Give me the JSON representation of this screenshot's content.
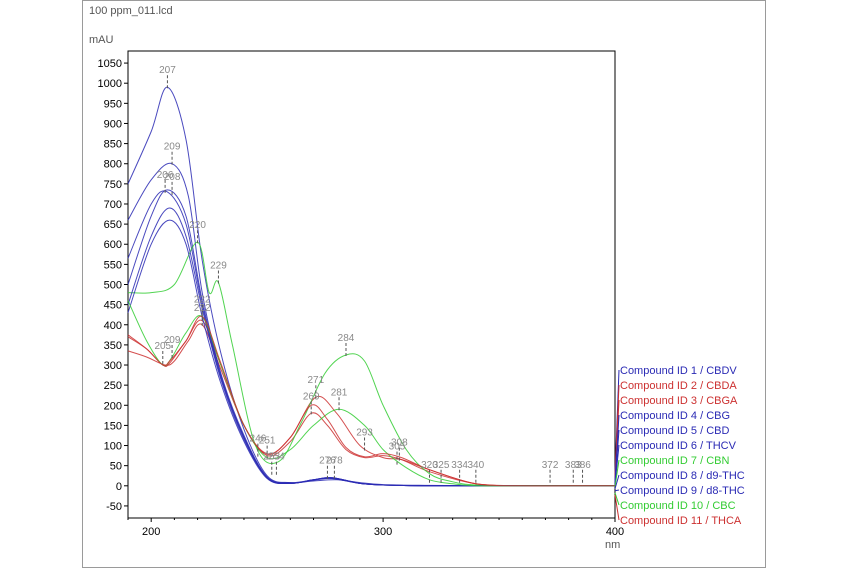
{
  "chart_data": {
    "type": "line",
    "title": "100 ppm_011.lcd",
    "ylabel": "mAU",
    "xlabel": "nm",
    "xlim": [
      190,
      400
    ],
    "ylim": [
      -80,
      1080
    ],
    "x_ticks": [
      200,
      300,
      400
    ],
    "y_ticks": [
      -50,
      0,
      50,
      100,
      150,
      200,
      250,
      300,
      350,
      400,
      450,
      500,
      550,
      600,
      650,
      700,
      750,
      800,
      850,
      900,
      950,
      1000,
      1050
    ],
    "grid": false,
    "legend_position": "right",
    "colors": {
      "blue": "#2a2ab4",
      "red": "#cc3030",
      "green": "#33cc33",
      "label_gray": "#8a8a8a"
    },
    "series": [
      {
        "name": "Compound ID 1 /  CBDV",
        "color": "#2a2ab4",
        "x": [
          190,
          200,
          207,
          215,
          222,
          230,
          240,
          250,
          260,
          270,
          280,
          290,
          300,
          320,
          340,
          360,
          380,
          400
        ],
        "y": [
          750,
          880,
          990,
          860,
          560,
          330,
          140,
          25,
          8,
          12,
          15,
          8,
          3,
          1,
          0,
          0,
          0,
          0
        ]
      },
      {
        "name": "Compound ID 2 /  CBDA",
        "color": "#cc3030",
        "x": [
          190,
          198,
          205,
          208,
          215,
          222,
          230,
          240,
          250,
          260,
          271,
          280,
          290,
          300,
          308,
          320,
          340,
          360,
          380,
          400
        ],
        "y": [
          375,
          340,
          300,
          305,
          360,
          410,
          300,
          150,
          80,
          120,
          220,
          180,
          100,
          70,
          65,
          40,
          5,
          0,
          0,
          0
        ]
      },
      {
        "name": "Compound ID 3 /  CBGA",
        "color": "#cc3030",
        "x": [
          190,
          198,
          206,
          210,
          216,
          222,
          230,
          240,
          250,
          260,
          269,
          276,
          284,
          292,
          300,
          308,
          320,
          340,
          360,
          380,
          400
        ],
        "y": [
          335,
          320,
          300,
          310,
          360,
          400,
          290,
          150,
          75,
          110,
          180,
          150,
          90,
          70,
          75,
          65,
          35,
          5,
          0,
          0,
          0
        ]
      },
      {
        "name": "Compound ID 4 /  CBG",
        "color": "#2a2ab4",
        "x": [
          190,
          200,
          207,
          215,
          222,
          230,
          240,
          250,
          260,
          270,
          278,
          290,
          300,
          320,
          340,
          360,
          380,
          400
        ],
        "y": [
          565,
          700,
          730,
          650,
          450,
          270,
          120,
          20,
          6,
          15,
          18,
          6,
          2,
          0,
          0,
          0,
          0,
          0
        ]
      },
      {
        "name": "Compound ID 5 /  CBD",
        "color": "#2a2ab4",
        "x": [
          190,
          200,
          207,
          215,
          222,
          230,
          240,
          250,
          260,
          270,
          278,
          290,
          300,
          320,
          340,
          360,
          380,
          400
        ],
        "y": [
          500,
          670,
          735,
          670,
          460,
          275,
          120,
          20,
          6,
          15,
          20,
          6,
          2,
          0,
          0,
          0,
          0,
          0
        ]
      },
      {
        "name": "Compound ID 6 /  THCV",
        "color": "#2a2ab4",
        "x": [
          190,
          200,
          209,
          216,
          222,
          230,
          240,
          250,
          260,
          270,
          278,
          290,
          300,
          320,
          340,
          360,
          380,
          400
        ],
        "y": [
          660,
          760,
          800,
          720,
          480,
          280,
          125,
          22,
          8,
          15,
          20,
          6,
          2,
          0,
          0,
          0,
          0,
          0
        ]
      },
      {
        "name": "Compound ID 7 /  CBN",
        "color": "#33cc33",
        "x": [
          190,
          200,
          210,
          220,
          225,
          229,
          235,
          245,
          255,
          265,
          275,
          284,
          292,
          300,
          310,
          320,
          330,
          340,
          360,
          380,
          400
        ],
        "y": [
          480,
          480,
          500,
          605,
          480,
          505,
          350,
          100,
          60,
          160,
          280,
          325,
          310,
          200,
          90,
          30,
          10,
          2,
          0,
          0,
          0
        ]
      },
      {
        "name": "Compound ID 8 /  d9-THC",
        "color": "#2a2ab4",
        "x": [
          190,
          200,
          208,
          215,
          222,
          230,
          240,
          250,
          260,
          270,
          278,
          290,
          300,
          320,
          340,
          360,
          380,
          400
        ],
        "y": [
          450,
          620,
          690,
          620,
          440,
          265,
          115,
          20,
          6,
          15,
          20,
          6,
          2,
          0,
          0,
          0,
          0,
          0
        ]
      },
      {
        "name": "Compound ID 9 /  d8-THC",
        "color": "#2a2ab4",
        "x": [
          190,
          200,
          208,
          215,
          222,
          230,
          240,
          250,
          260,
          270,
          278,
          290,
          300,
          320,
          340,
          360,
          380,
          400
        ],
        "y": [
          430,
          600,
          660,
          600,
          420,
          255,
          110,
          18,
          6,
          14,
          18,
          6,
          2,
          0,
          0,
          0,
          0,
          0
        ]
      },
      {
        "name": "Compound ID 10 /  CBC",
        "color": "#33cc33",
        "x": [
          190,
          198,
          205,
          209,
          215,
          222,
          230,
          240,
          250,
          260,
          270,
          281,
          292,
          300,
          310,
          320,
          330,
          340,
          360,
          380,
          400
        ],
        "y": [
          460,
          360,
          300,
          320,
          380,
          420,
          300,
          150,
          70,
          90,
          150,
          190,
          150,
          90,
          45,
          15,
          5,
          0,
          0,
          0,
          0
        ]
      },
      {
        "name": "Compound ID 11 /  THCA",
        "color": "#cc3030",
        "x": [
          190,
          198,
          205,
          208,
          215,
          222,
          230,
          240,
          250,
          260,
          269,
          276,
          284,
          292,
          300,
          308,
          320,
          340,
          360,
          380,
          400
        ],
        "y": [
          370,
          340,
          300,
          310,
          360,
          420,
          305,
          150,
          78,
          120,
          200,
          165,
          95,
          72,
          80,
          70,
          40,
          5,
          0,
          0,
          0
        ]
      }
    ],
    "peak_labels": [
      {
        "text": "207",
        "x": 207,
        "y": 990
      },
      {
        "text": "209",
        "x": 209,
        "y": 800
      },
      {
        "text": "206",
        "x": 206,
        "y": 730
      },
      {
        "text": "208",
        "x": 209,
        "y": 725
      },
      {
        "text": "220",
        "x": 220,
        "y": 605
      },
      {
        "text": "229",
        "x": 229,
        "y": 505
      },
      {
        "text": "222",
        "x": 222,
        "y": 420
      },
      {
        "text": "222",
        "x": 222,
        "y": 400
      },
      {
        "text": "209",
        "x": 209,
        "y": 320
      },
      {
        "text": "205",
        "x": 205,
        "y": 305
      },
      {
        "text": "284",
        "x": 284,
        "y": 325
      },
      {
        "text": "271",
        "x": 271,
        "y": 220
      },
      {
        "text": "281",
        "x": 281,
        "y": 190
      },
      {
        "text": "269",
        "x": 269,
        "y": 180
      },
      {
        "text": "293",
        "x": 292,
        "y": 90
      },
      {
        "text": "308",
        "x": 307,
        "y": 65
      },
      {
        "text": "305",
        "x": 306,
        "y": 55
      },
      {
        "text": "246",
        "x": 246,
        "y": 75
      },
      {
        "text": "251",
        "x": 250,
        "y": 70
      },
      {
        "text": "253",
        "x": 252,
        "y": 30
      },
      {
        "text": "254",
        "x": 254,
        "y": 30
      },
      {
        "text": "276",
        "x": 276,
        "y": 20
      },
      {
        "text": "278",
        "x": 279,
        "y": 20
      },
      {
        "text": "320",
        "x": 320,
        "y": 10
      },
      {
        "text": "325",
        "x": 325,
        "y": 10
      },
      {
        "text": "334",
        "x": 333,
        "y": 10
      },
      {
        "text": "340",
        "x": 340,
        "y": 10
      },
      {
        "text": "372",
        "x": 372,
        "y": 10
      },
      {
        "text": "383",
        "x": 382,
        "y": 10
      },
      {
        "text": "386",
        "x": 386,
        "y": 10
      }
    ]
  }
}
